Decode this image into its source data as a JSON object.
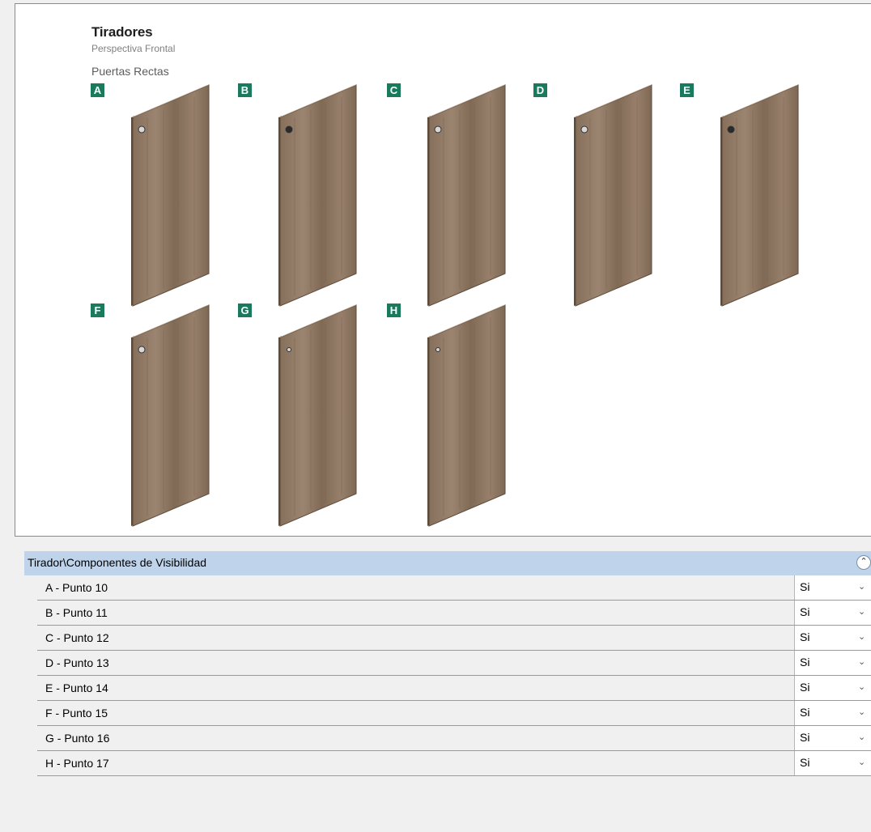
{
  "preview": {
    "title": "Tiradores",
    "subtitle": "Perspectiva Frontal",
    "section": "Puertas Rectas",
    "doors": [
      {
        "letter": "A",
        "handle": "round-knob-icon"
      },
      {
        "letter": "B",
        "handle": "dark-knob-icon"
      },
      {
        "letter": "C",
        "handle": "pull-handle-icon"
      },
      {
        "letter": "D",
        "handle": "square-handle-icon"
      },
      {
        "letter": "E",
        "handle": "dark-knob-icon"
      },
      {
        "letter": "F",
        "handle": "round-knob-icon"
      },
      {
        "letter": "G",
        "handle": "small-knob-icon"
      },
      {
        "letter": "H",
        "handle": "small-knob-icon"
      }
    ]
  },
  "props": {
    "header": "Tirador\\Componentes de Visibilidad",
    "collapse_icon": "chevron-up-double-icon",
    "rows": [
      {
        "label": "A - Punto 10",
        "value": "Si"
      },
      {
        "label": "B - Punto 11",
        "value": "Si"
      },
      {
        "label": "C - Punto 12",
        "value": "Si"
      },
      {
        "label": "D - Punto 13",
        "value": "Si"
      },
      {
        "label": "E - Punto 14",
        "value": "Si"
      },
      {
        "label": "F - Punto 15",
        "value": "Si"
      },
      {
        "label": "G - Punto 16",
        "value": "Si"
      },
      {
        "label": "H - Punto 17",
        "value": "Si"
      }
    ]
  },
  "colors": {
    "badge": "#1a7a5e",
    "wood": "#8c7662",
    "header_bg": "#bfd4ea"
  }
}
